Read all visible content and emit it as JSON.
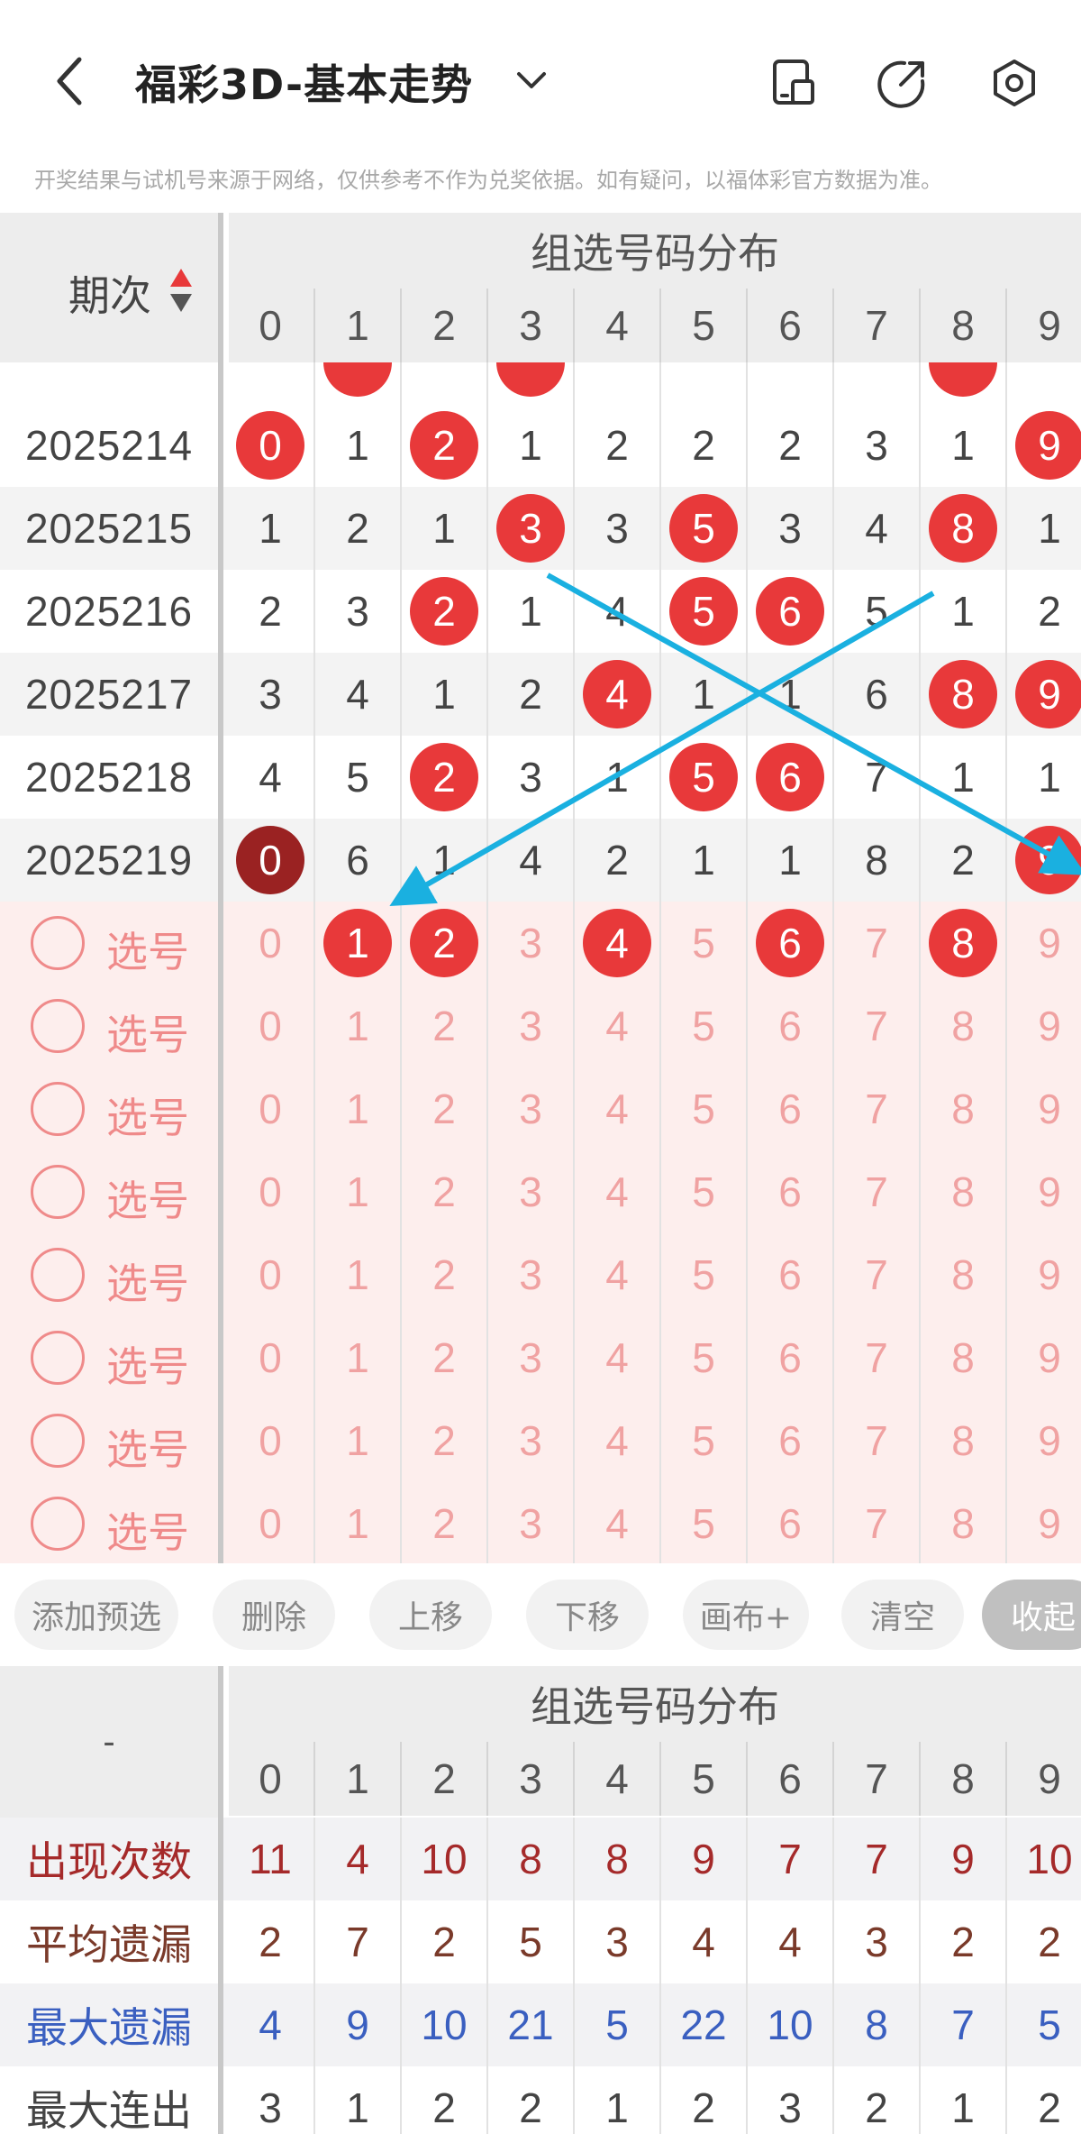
{
  "header": {
    "title": "福彩3D-基本走势",
    "notice": "开奖结果与试机号来源于网络，仅供参考不作为兑奖依据。如有疑问，以福体彩官方数据为准。",
    "icons": [
      "back-icon",
      "chevron-down-icon",
      "phone-icon",
      "share-icon",
      "settings-icon"
    ]
  },
  "grid": {
    "corner_label": "期次",
    "section_title": "组选号码分布",
    "digits": [
      "0",
      "1",
      "2",
      "3",
      "4",
      "5",
      "6",
      "7",
      "8",
      "9"
    ],
    "partial_row": {
      "values": [
        "",
        "",
        "",
        "",
        "",
        "",
        "",
        "",
        "",
        ""
      ],
      "balls": [
        1,
        3,
        8
      ]
    },
    "rows": [
      {
        "issue": "2025214",
        "values": [
          "0",
          "1",
          "2",
          "1",
          "2",
          "2",
          "2",
          "3",
          "1",
          "9"
        ],
        "balls": [
          0,
          2,
          9
        ]
      },
      {
        "issue": "2025215",
        "values": [
          "1",
          "2",
          "1",
          "3",
          "3",
          "5",
          "3",
          "4",
          "8",
          "1"
        ],
        "balls": [
          3,
          5,
          8
        ]
      },
      {
        "issue": "2025216",
        "values": [
          "2",
          "3",
          "2",
          "1",
          "4",
          "5",
          "6",
          "5",
          "1",
          "2"
        ],
        "balls": [
          2,
          5,
          6
        ]
      },
      {
        "issue": "2025217",
        "values": [
          "3",
          "4",
          "1",
          "2",
          "4",
          "1",
          "1",
          "6",
          "8",
          "9"
        ],
        "balls": [
          4,
          8,
          9
        ]
      },
      {
        "issue": "2025218",
        "values": [
          "4",
          "5",
          "2",
          "3",
          "1",
          "5",
          "6",
          "7",
          "1",
          "1"
        ],
        "balls": [
          2,
          5,
          6
        ]
      },
      {
        "issue": "2025219",
        "values": [
          "0",
          "6",
          "1",
          "4",
          "2",
          "1",
          "1",
          "8",
          "2",
          "9"
        ],
        "balls": [
          0,
          9
        ],
        "dark_balls": [
          0
        ]
      }
    ],
    "select_label": "选号",
    "select_rows": [
      {
        "balls": [
          1,
          2,
          4,
          6,
          8
        ]
      },
      {
        "balls": []
      },
      {
        "balls": []
      },
      {
        "balls": []
      },
      {
        "balls": []
      },
      {
        "balls": []
      },
      {
        "balls": []
      },
      {
        "balls": []
      }
    ]
  },
  "toolbar": {
    "buttons": [
      "添加预选",
      "删除",
      "上移",
      "下移",
      "画布+",
      "清空",
      "收起"
    ]
  },
  "stats": {
    "corner_label": "-",
    "section_title": "组选号码分布",
    "digits": [
      "0",
      "1",
      "2",
      "3",
      "4",
      "5",
      "6",
      "7",
      "8",
      "9"
    ],
    "rows": [
      {
        "label": "出现次数",
        "values": [
          "11",
          "4",
          "10",
          "8",
          "8",
          "9",
          "7",
          "7",
          "9",
          "10"
        ],
        "color": "#a52a2a"
      },
      {
        "label": "平均遗漏",
        "values": [
          "2",
          "7",
          "2",
          "5",
          "3",
          "4",
          "4",
          "3",
          "2",
          "2"
        ],
        "color": "#7a3a2a"
      },
      {
        "label": "最大遗漏",
        "values": [
          "4",
          "9",
          "10",
          "21",
          "5",
          "22",
          "10",
          "8",
          "7",
          "5"
        ],
        "color": "#3a5fc0"
      },
      {
        "label": "最大连出",
        "values": [
          "3",
          "1",
          "2",
          "2",
          "1",
          "2",
          "3",
          "2",
          "1",
          "2"
        ],
        "color": "#444444"
      }
    ]
  },
  "colors": {
    "ball": "#e8393a",
    "ball_dark": "#9a2222",
    "arrow": "#1ab0e0",
    "select_bg": "#fdeeed"
  }
}
